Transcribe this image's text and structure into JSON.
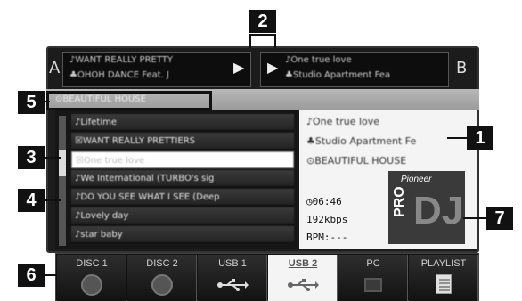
{
  "callouts": [
    "1",
    "2",
    "3",
    "4",
    "5",
    "6",
    "7"
  ],
  "deck_a": {
    "letter": "A",
    "line1": "♪WANT REALLY PRETTY",
    "line2": "♣OHOH DANCE Feat. J"
  },
  "deck_b": {
    "letter": "B",
    "line1": "♪One true love",
    "line2": "♣Studio Apartment Fea"
  },
  "play_symbol": "▶",
  "path": "⊙BEAUTIFUL HOUSE",
  "tracks": [
    "♪Lifetime",
    "☒WANT REALLY PRETTIERS",
    "☒One true love",
    "♪We International (TURBO's sig",
    "♪DO YOU SEE WHAT I SEE (Deep",
    "♪Lovely day",
    "♪star baby"
  ],
  "info": {
    "title": "♪One true love",
    "artist": "♣Studio Apartment Fe",
    "album": "⊙BEAUTIFUL HOUSE",
    "time": "◷06:46",
    "bitrate": "192kbps",
    "bpm": "BPM:---"
  },
  "logo": {
    "brand": "Pioneer",
    "pro": "PRO",
    "dj": "DJ"
  },
  "tabs": [
    {
      "label": "DISC 1",
      "icon": "disc-icon"
    },
    {
      "label": "DISC 2",
      "icon": "disc-icon"
    },
    {
      "label": "USB 1",
      "icon": "usb-icon"
    },
    {
      "label": "USB 2",
      "icon": "usb-icon",
      "active": true
    },
    {
      "label": "PC",
      "icon": "computer-icon"
    },
    {
      "label": "PLAYLIST",
      "icon": "playlist-icon"
    }
  ],
  "colors": {
    "background": "#ffffff",
    "screen": "#1c1c1c",
    "callout": "#111111",
    "selected": "#ffffff"
  }
}
